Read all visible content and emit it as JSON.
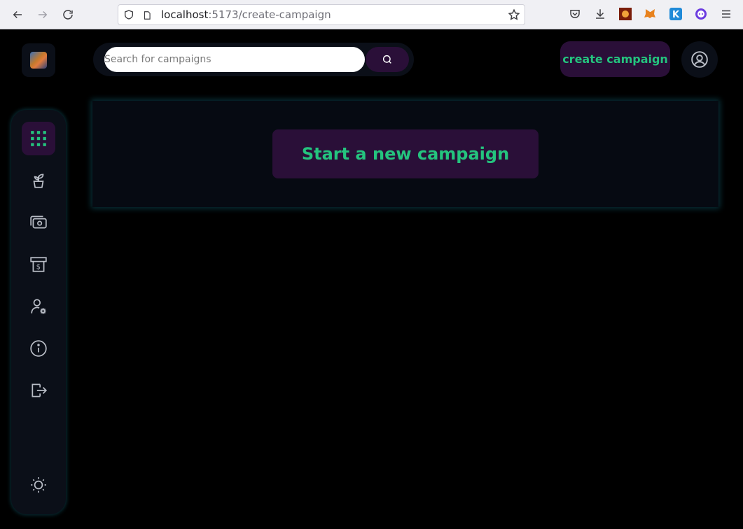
{
  "browser": {
    "url_host": "localhost",
    "url_rest": ":5173/create-campaign"
  },
  "header": {
    "search_placeholder": "Search for campaigns",
    "create_label": "create campaign"
  },
  "sidebar": {
    "items": [
      {
        "name": "dashboard",
        "icon": "grid-icon",
        "active": true
      },
      {
        "name": "campaign",
        "icon": "sprout-icon"
      },
      {
        "name": "payment",
        "icon": "money-icon"
      },
      {
        "name": "withdraw",
        "icon": "withdraw-icon"
      },
      {
        "name": "profile",
        "icon": "user-settings-icon"
      },
      {
        "name": "info",
        "icon": "info-icon"
      },
      {
        "name": "logout",
        "icon": "logout-icon"
      }
    ],
    "theme_icon": "sun-icon"
  },
  "main": {
    "heading": "Start a new campaign"
  },
  "colors": {
    "accent": "#24c47e",
    "button_bg": "#2a0f38",
    "panel_bg": "#0b0f18",
    "page_bg": "#000000"
  }
}
